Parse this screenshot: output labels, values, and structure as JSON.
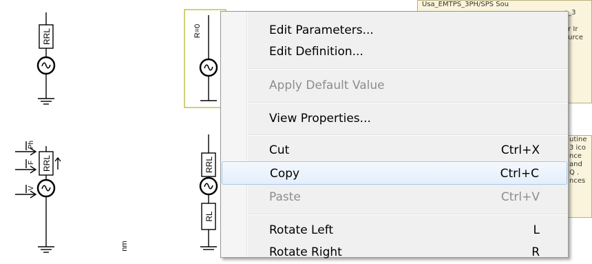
{
  "schematic": {
    "labels": {
      "rrl": "RRL",
      "r0": "R=0",
      "rl": "RL",
      "ph": "Ph",
      "f": "F",
      "v": "V",
      "nm": "nm"
    },
    "notes": {
      "top_line1": "Usa_EMTPS_3PH/SPS Sou",
      "top_line2": "e_3",
      "top_line3": "or Ir",
      "top_line4": "ource",
      "mid_line1": "utine",
      "mid_line2": "3 ico",
      "mid_line3": "nce",
      "mid_line4": "and",
      "mid_line5": "Q .",
      "mid_line6": "nces"
    }
  },
  "context_menu": {
    "items": [
      {
        "label": "Edit Parameters...",
        "shortcut": "",
        "disabled": false
      },
      {
        "label": "Edit Definition...",
        "shortcut": "",
        "disabled": false
      },
      {
        "label": "Apply Default Value",
        "shortcut": "",
        "disabled": true
      },
      {
        "label": "View Properties...",
        "shortcut": "",
        "disabled": false
      },
      {
        "label": "Cut",
        "shortcut": "Ctrl+X",
        "disabled": false
      },
      {
        "label": "Copy",
        "shortcut": "Ctrl+C",
        "disabled": false,
        "selected": true
      },
      {
        "label": "Paste",
        "shortcut": "Ctrl+V",
        "disabled": true
      },
      {
        "label": "Rotate Left",
        "shortcut": "L",
        "disabled": false
      },
      {
        "label": "Rotate Right",
        "shortcut": "R",
        "disabled": false
      }
    ]
  },
  "colors": {
    "menu_bg": "#f0f0f0",
    "selection_border": "#a8c8ec",
    "disabled_text": "#8d8d8d",
    "selected_component_frame": "#b5b020"
  }
}
